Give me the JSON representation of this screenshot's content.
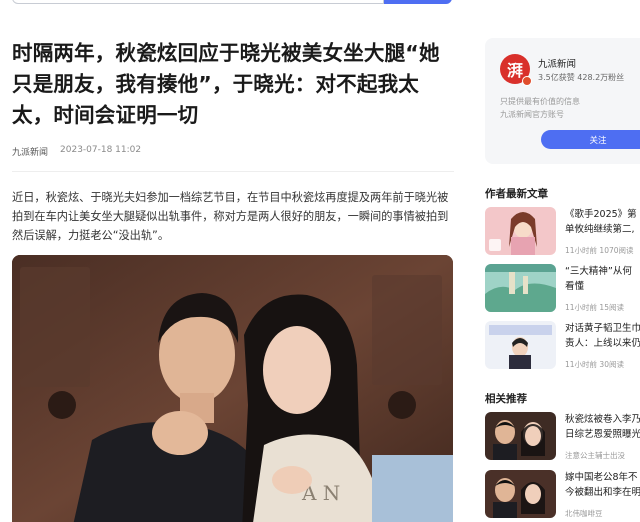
{
  "article": {
    "title": "时隔两年，秋瓷炫回应于晓光被美女坐大腿“她只是朋友，我有揍他”，于晓光：对不起我太太，时间会证明一切",
    "source": "九派新闻",
    "datetime": "2023-07-18 11:02",
    "body": "近日，秋瓷炫、于晓光夫妇参加一档综艺节目，在节目中秋瓷炫再度提及两年前于晓光被拍到在车内让美女坐大腿疑似出轨事件，称对方是两人很好的朋友，一瞬间的事情被拍到然后误解，力挺老公“没出轨”。"
  },
  "author": {
    "avatar_char": "湃",
    "name": "九派新闻",
    "stats": "3.5亿获赞 428.2万粉丝",
    "desc_line1": "只提供最有价值的信息",
    "desc_line2": "九派新闻官方账号",
    "follow_label": "关注"
  },
  "latest": {
    "heading": "作者最新文章",
    "items": [
      {
        "title_line1": "《歌手2025》第",
        "title_line2": "单攸纯继续第二,",
        "meta": "11小时前   1070阅读"
      },
      {
        "title_line1": "“三大精神”从何",
        "title_line2": "看懂",
        "meta": "11小时前   15阅读"
      },
      {
        "title_line1": "对话黄子韬卫生巾",
        "title_line2": "责人：上线以来仍",
        "meta": "11小时前   30阅读"
      }
    ]
  },
  "related": {
    "heading": "相关推荐",
    "items": [
      {
        "title_line1": "秋瓷炫被卷入李乃",
        "title_line2": "日综艺恩爱照曝光",
        "meta": "注意公主辅士出没"
      },
      {
        "title_line1": "嫁中国老公8年不",
        "title_line2": "今被翻出和李在明",
        "meta": "北伟咖啡豆"
      }
    ]
  },
  "colors": {
    "accent": "#4e6ef2",
    "brand_red": "#d9302b"
  }
}
